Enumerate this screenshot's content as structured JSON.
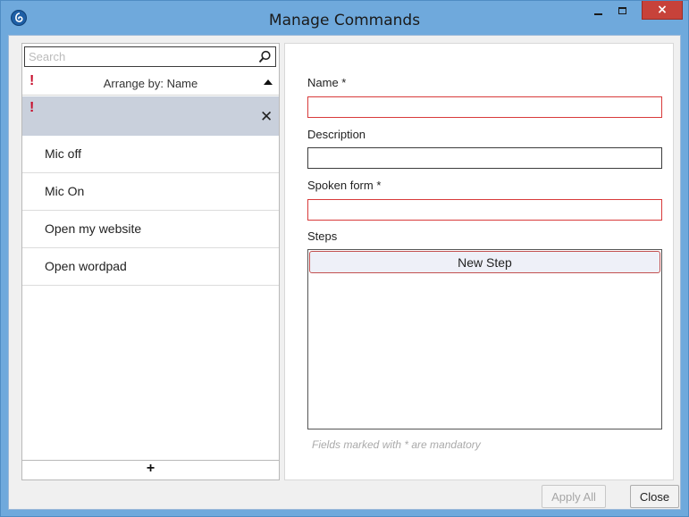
{
  "window": {
    "title": "Manage Commands",
    "close_glyph": "×",
    "colors": {
      "titlebar": "#6fa9dc",
      "close": "#c7423a",
      "invalid_border": "#d83a3a",
      "warning": "#c8102e"
    }
  },
  "sidebar": {
    "search": {
      "placeholder": "Search",
      "value": ""
    },
    "arrange": {
      "warning": "!",
      "label": "Arrange by: Name",
      "sort": "ascending"
    },
    "new_item": {
      "warning": "!",
      "delete_glyph": "✕"
    },
    "items": [
      {
        "label": "Mic off"
      },
      {
        "label": "Mic On"
      },
      {
        "label": "Open my website"
      },
      {
        "label": "Open wordpad"
      }
    ],
    "add_label": "+"
  },
  "form": {
    "name": {
      "label": "Name *",
      "value": ""
    },
    "description": {
      "label": "Description",
      "value": ""
    },
    "spoken_form": {
      "label": "Spoken form *",
      "value": ""
    },
    "steps": {
      "label": "Steps",
      "new_step_label": "New Step"
    },
    "hint": "Fields marked with * are mandatory"
  },
  "footer": {
    "apply_all_label": "Apply All",
    "close_label": "Close"
  },
  "icons": [
    "app-icon",
    "search-icon",
    "warning-icon",
    "sort-ascending-icon",
    "delete-icon",
    "minimize-icon",
    "maximize-icon",
    "close-icon"
  ]
}
